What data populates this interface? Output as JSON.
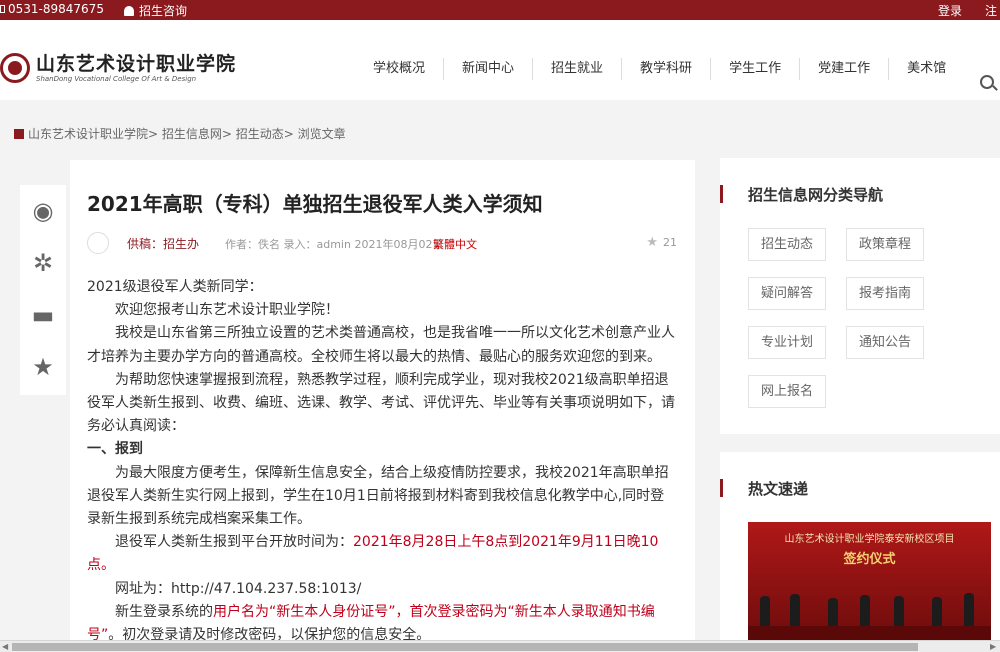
{
  "topbar": {
    "phone": "0531-89847675",
    "consult": "招生咨询",
    "login": "登录",
    "register": "注"
  },
  "logo": {
    "cn": "山东艺术设计职业学院",
    "en": "ShanDong Vocational College Of Art & Design"
  },
  "nav": [
    "学校概况",
    "新闻中心",
    "招生就业",
    "教学科研",
    "学生工作",
    "党建工作",
    "美术馆"
  ],
  "breadcrumb": "山东艺术设计职业学院> 招生信息网> 招生动态> 浏览文章",
  "article": {
    "title": "2021年高职（专科）单独招生退役军人类入学须知",
    "source": "供稿：招生办",
    "author_line": "作者：佚名   录入：admin  2021年08月02日",
    "traditional": "繁體中文",
    "likes": "21",
    "p1": "2021级退役军人类新同学：",
    "p2": "欢迎您报考山东艺术设计职业学院！",
    "p3": "我校是山东省第三所独立设置的艺术类普通高校，也是我省唯一一所以文化艺术创意产业人才培养为主要办学方向的普通高校。全校师生将以最大的热情、最贴心的服务欢迎您的到来。",
    "p4": "为帮助您快速掌握报到流程，熟悉教学过程，顺利完成学业，现对我校2021级高职单招退役军人类新生报到、收费、编班、选课、教学、考试、评优评先、毕业等有关事项说明如下，请务必认真阅读：",
    "h1": "一、报到",
    "p5": "为最大限度方便考生，保障新生信息安全，结合上级疫情防控要求，我校2021年高职单招退役军人类新生实行网上报到，学生在10月1日前将报到材料寄到我校信息化教学中心,同时登录新生报到系统完成档案采集工作。",
    "p6_a": "退役军人类新生报到平台开放时间为：",
    "p6_b": "2021年8月28日上午8点到2021年9月11日晚10点。",
    "p7": "网址为：http://47.104.237.58:1013/",
    "p8_a": "新生登录系统的",
    "p8_b": "用户名为“新生本人身份证号”，首次登录密码为“新生本人录取通知书编号”",
    "p8_c": "。初次登录请及时修改密码，以保护您的信息安全。"
  },
  "sidebar": {
    "title": "招生信息网分类导航",
    "tags": [
      "招生动态",
      "政策章程",
      "疑问解答",
      "报考指南",
      "专业计划",
      "通知公告",
      "网上报名"
    ]
  },
  "hot": {
    "title": "热文速递",
    "caption1": "山东艺术设计职业学院泰安新校区项目",
    "caption2": "签约仪式"
  },
  "colors": {
    "brand": "#8b1a1f",
    "highlight": "#c0001a"
  }
}
